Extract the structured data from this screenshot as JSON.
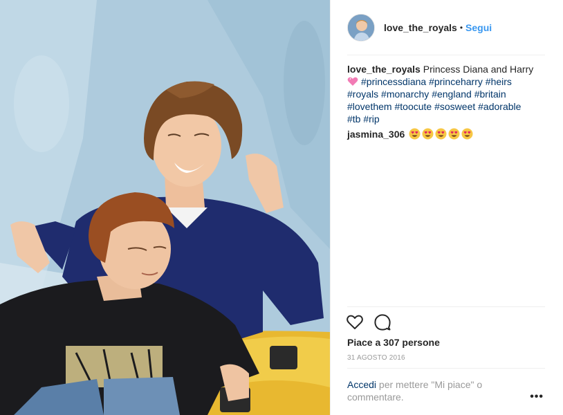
{
  "post": {
    "image_alt": "Princess Diana and Harry",
    "header": {
      "username": "love_the_royals",
      "separator": "•",
      "follow_label": "Segui"
    },
    "caption": {
      "username": "love_the_royals",
      "text": "Princess Diana and Harry",
      "hashtags": [
        "#princessdiana",
        "#princeharry",
        "#heirs",
        "#royals",
        "#monarchy",
        "#england",
        "#britain",
        "#lovethem",
        "#toocute",
        "#sosweet",
        "#adorable",
        "#tb",
        "#rip"
      ]
    },
    "comments": [
      {
        "username": "jasmina_306",
        "emojis": [
          "heart-eyes-emoji",
          "heart-eyes-emoji",
          "heart-eyes-emoji",
          "heart-eyes-emoji",
          "heart-eyes-emoji"
        ]
      }
    ],
    "actions": {
      "like_icon": "heart-outline-icon",
      "comment_icon": "comment-bubble-icon"
    },
    "likes_text": "Piace a 307 persone",
    "date": "31 AGOSTO 2016",
    "login_prompt": {
      "link": "Accedi",
      "text": " per mettere \"Mi piace\" o commentare."
    },
    "more_label": "•••"
  },
  "colors": {
    "link_blue": "#3897f0",
    "hashtag_blue": "#003569",
    "muted": "#999999",
    "divider": "#efefef"
  }
}
